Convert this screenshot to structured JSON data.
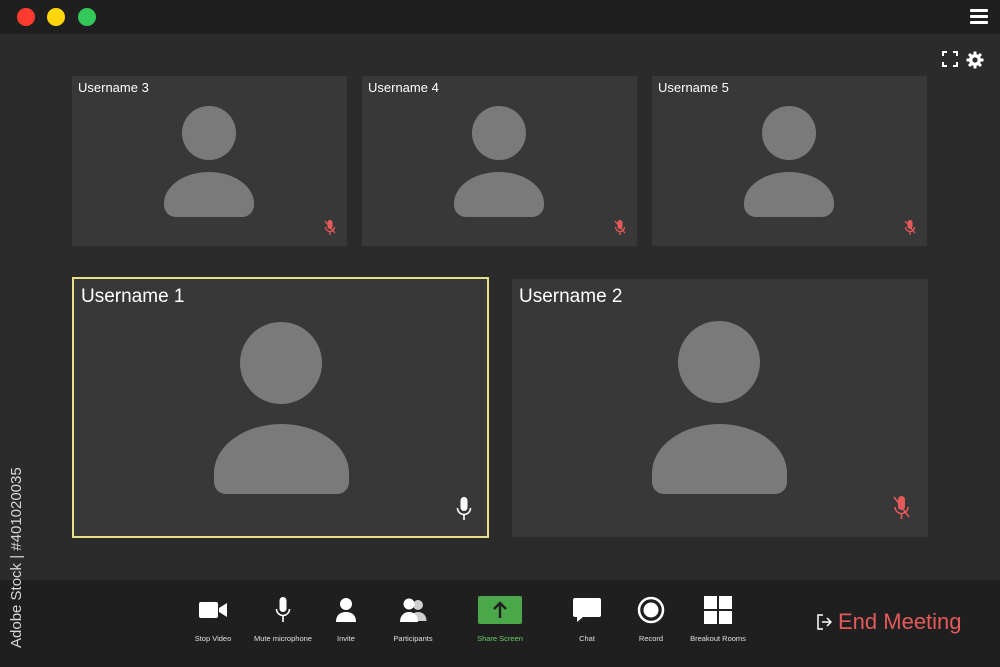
{
  "colors": {
    "window_close": "#ff3b30",
    "window_minimize": "#ffd60a",
    "window_maximize": "#34c759",
    "active_speaker_border": "#e6e08a",
    "muted_mic": "#e45a5a",
    "share_screen": "#4aa84a",
    "end_meeting": "#e45a5a"
  },
  "participants_top": [
    {
      "name": "Username 3",
      "mic": "muted"
    },
    {
      "name": "Username 4",
      "mic": "muted"
    },
    {
      "name": "Username 5",
      "mic": "muted"
    }
  ],
  "participants_bottom": [
    {
      "name": "Username 1",
      "mic": "on",
      "active": true
    },
    {
      "name": "Username 2",
      "mic": "muted",
      "active": false
    }
  ],
  "toolbar": {
    "items": [
      {
        "label": "Stop Video",
        "icon": "video-camera-icon"
      },
      {
        "label": "Mute microphone",
        "icon": "microphone-icon"
      },
      {
        "label": "Invite",
        "icon": "person-icon"
      },
      {
        "label": "Participants",
        "icon": "people-icon"
      },
      {
        "label": "Share Screen",
        "icon": "share-screen-icon"
      },
      {
        "label": "Chat",
        "icon": "chat-icon"
      },
      {
        "label": "Record",
        "icon": "record-icon"
      },
      {
        "label": "Breakout Rooms",
        "icon": "grid-icon"
      }
    ],
    "end_meeting": "End Meeting"
  },
  "watermark": "Adobe Stock | #401020035"
}
